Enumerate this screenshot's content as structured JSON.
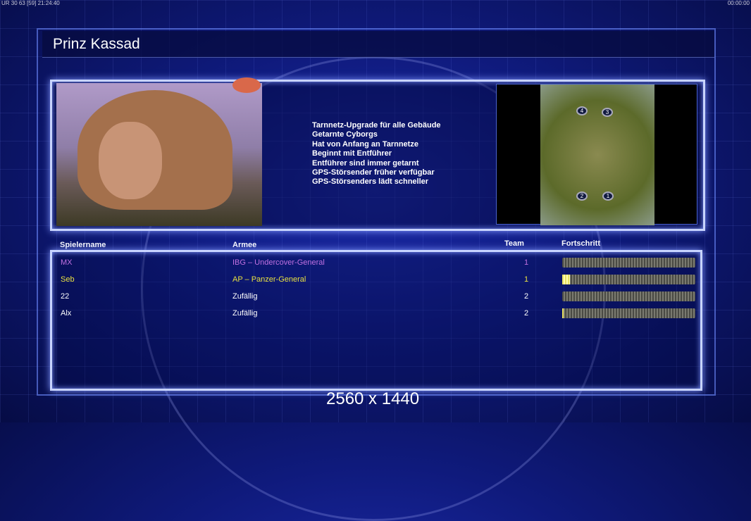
{
  "hud": {
    "left": "UR 30 63 [59] 21:24:40",
    "right": "00:00:00"
  },
  "title": "Prinz Kassad",
  "features": [
    "Tarnnetz-Upgrade für alle Gebäude",
    "Getarnte Cyborgs",
    "Hat von Anfang an Tarnnetze",
    "Beginnt mit Entführer",
    "Entführer sind immer getarnt",
    "GPS-Störsender früher verfügbar",
    "GPS-Störsenders lädt schneller"
  ],
  "map": {
    "spawns": [
      "4",
      "3",
      "2",
      "1"
    ]
  },
  "table": {
    "headers": {
      "name": "Spielername",
      "army": "Armee",
      "team": "Team",
      "progress": "Fortschritt"
    },
    "rows": [
      {
        "name": "MX",
        "army": "IBG – Undercover-General",
        "team": "1",
        "progress": 0,
        "color": "#c070e0"
      },
      {
        "name": "Seb",
        "army": "AP – Panzer-General",
        "team": "1",
        "progress": 6,
        "color": "#e8e040"
      },
      {
        "name": "22",
        "army": "Zufällig",
        "team": "2",
        "progress": 0,
        "color": "#ffffff"
      },
      {
        "name": "Alx",
        "army": "Zufällig",
        "team": "2",
        "progress": 1,
        "color": "#ffffff"
      }
    ]
  },
  "resolution": "2560 x 1440"
}
